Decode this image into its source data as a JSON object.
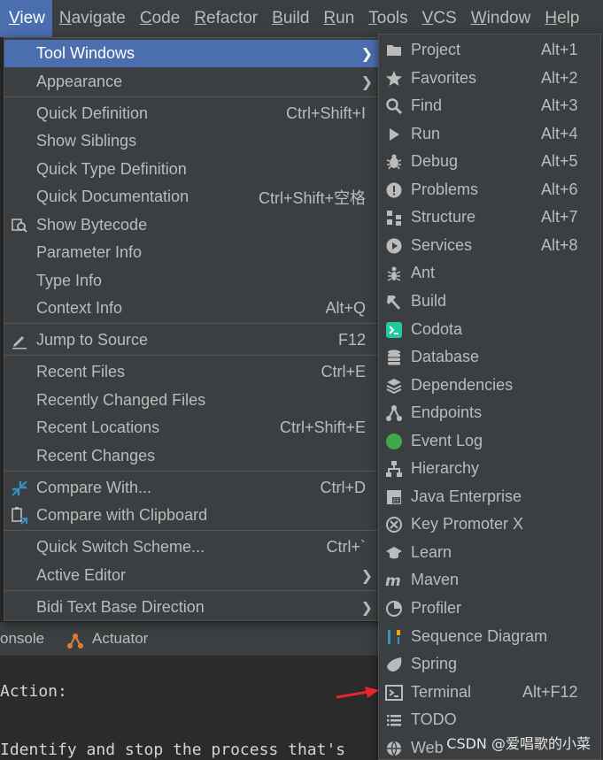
{
  "menubar": {
    "items": [
      "View",
      "Navigate",
      "Code",
      "Refactor",
      "Build",
      "Run",
      "Tools",
      "VCS",
      "Window",
      "Help"
    ]
  },
  "view_menu": {
    "tool_windows": "Tool Windows",
    "appearance": "Appearance",
    "quick_definition": "Quick Definition",
    "quick_definition_sc": "Ctrl+Shift+I",
    "show_siblings": "Show Siblings",
    "quick_type_definition": "Quick Type Definition",
    "quick_documentation": "Quick Documentation",
    "quick_documentation_sc": "Ctrl+Shift+空格",
    "show_bytecode": "Show Bytecode",
    "parameter_info": "Parameter Info",
    "type_info": "Type Info",
    "context_info": "Context Info",
    "context_info_sc": "Alt+Q",
    "jump_to_source": "Jump to Source",
    "jump_to_source_sc": "F12",
    "recent_files": "Recent Files",
    "recent_files_sc": "Ctrl+E",
    "recently_changed_files": "Recently Changed Files",
    "recent_locations": "Recent Locations",
    "recent_locations_sc": "Ctrl+Shift+E",
    "recent_changes": "Recent Changes",
    "compare_with": "Compare With...",
    "compare_with_sc": "Ctrl+D",
    "compare_with_clipboard": "Compare with Clipboard",
    "quick_switch_scheme": "Quick Switch Scheme...",
    "quick_switch_scheme_sc": "Ctrl+`",
    "active_editor": "Active Editor",
    "bidi_text": "Bidi Text Base Direction"
  },
  "tool_windows": {
    "items": [
      {
        "label": "Project",
        "shortcut": "Alt+1",
        "icon": "folder-icon"
      },
      {
        "label": "Favorites",
        "shortcut": "Alt+2",
        "icon": "star-icon"
      },
      {
        "label": "Find",
        "shortcut": "Alt+3",
        "icon": "search-icon"
      },
      {
        "label": "Run",
        "shortcut": "Alt+4",
        "icon": "play-icon"
      },
      {
        "label": "Debug",
        "shortcut": "Alt+5",
        "icon": "bug-icon"
      },
      {
        "label": "Problems",
        "shortcut": "Alt+6",
        "icon": "alert-icon"
      },
      {
        "label": "Structure",
        "shortcut": "Alt+7",
        "icon": "structure-icon"
      },
      {
        "label": "Services",
        "shortcut": "Alt+8",
        "icon": "services-icon"
      },
      {
        "label": "Ant",
        "shortcut": "",
        "icon": "ant-icon"
      },
      {
        "label": "Build",
        "shortcut": "",
        "icon": "hammer-icon"
      },
      {
        "label": "Codota",
        "shortcut": "",
        "icon": "codota-icon"
      },
      {
        "label": "Database",
        "shortcut": "",
        "icon": "database-icon"
      },
      {
        "label": "Dependencies",
        "shortcut": "",
        "icon": "layers-icon"
      },
      {
        "label": "Endpoints",
        "shortcut": "",
        "icon": "endpoints-icon"
      },
      {
        "label": "Event Log",
        "shortcut": "",
        "icon": "event-log-icon"
      },
      {
        "label": "Hierarchy",
        "shortcut": "",
        "icon": "hierarchy-icon"
      },
      {
        "label": "Java Enterprise",
        "shortcut": "",
        "icon": "java-enterprise-icon"
      },
      {
        "label": "Key Promoter X",
        "shortcut": "",
        "icon": "key-promoter-icon"
      },
      {
        "label": "Learn",
        "shortcut": "",
        "icon": "learn-icon"
      },
      {
        "label": "Maven",
        "shortcut": "",
        "icon": "maven-icon"
      },
      {
        "label": "Profiler",
        "shortcut": "",
        "icon": "profiler-icon"
      },
      {
        "label": "Sequence Diagram",
        "shortcut": "",
        "icon": "sequence-diagram-icon"
      },
      {
        "label": "Spring",
        "shortcut": "",
        "icon": "spring-icon"
      },
      {
        "label": "Terminal",
        "shortcut": "Alt+F12",
        "icon": "terminal-icon"
      },
      {
        "label": "TODO",
        "shortcut": "",
        "icon": "todo-icon"
      },
      {
        "label": "Web",
        "shortcut": "",
        "icon": "web-icon"
      }
    ]
  },
  "background": {
    "tab_console": "onsole",
    "tab_actuator": "Actuator",
    "console_line1": "Action:",
    "console_line2": "Identify and stop the process that's"
  },
  "watermark": "CSDN @爱唱歌的小菜"
}
